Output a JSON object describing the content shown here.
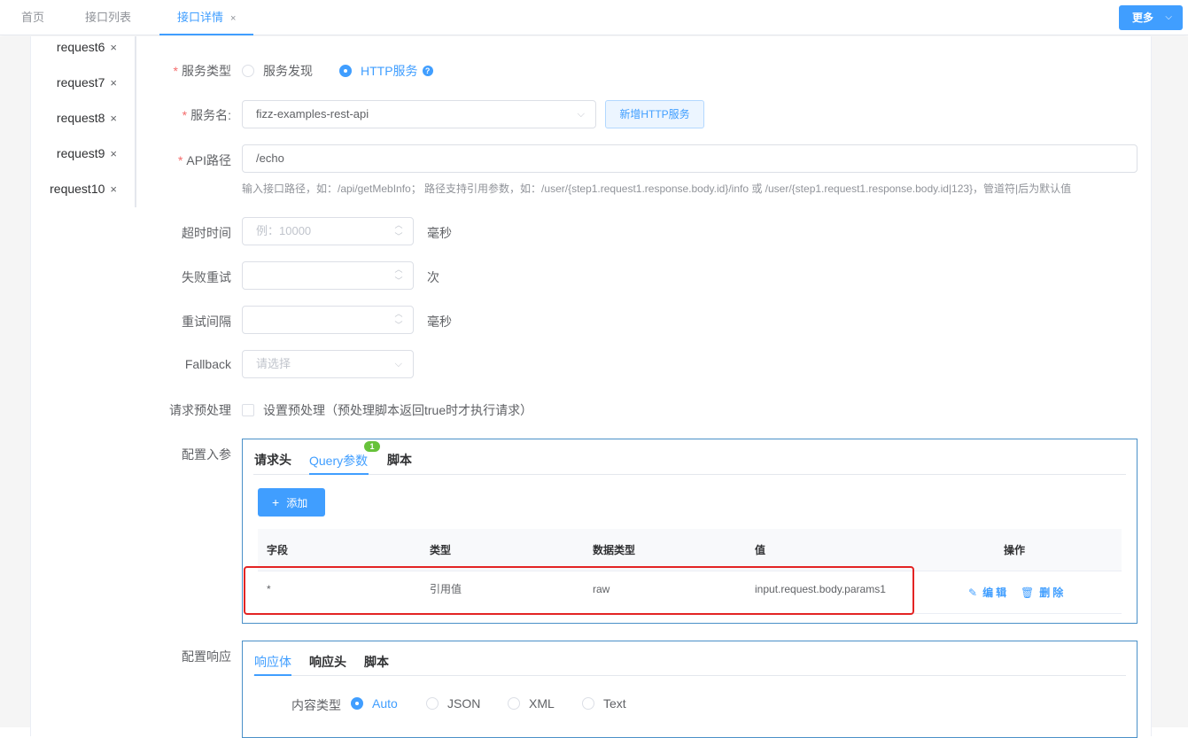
{
  "tabs": [
    {
      "label": "首页"
    },
    {
      "label": "接口列表"
    },
    {
      "label": "接口详情",
      "close": "×"
    }
  ],
  "more_button": {
    "label": "更多",
    "chevron": "⌵"
  },
  "side_requests": [
    {
      "label": "request6",
      "close": "×"
    },
    {
      "label": "request7",
      "close": "×"
    },
    {
      "label": "request8",
      "close": "×"
    },
    {
      "label": "request9",
      "close": "×"
    },
    {
      "label": "request10",
      "close": "×"
    }
  ],
  "form": {
    "service_type": {
      "label": "服务类型",
      "required": "*",
      "options": [
        "服务发现",
        "HTTP服务"
      ],
      "selected": "HTTP服务",
      "help": "?"
    },
    "service_name": {
      "label": "服务名:",
      "required": "*",
      "value": "fizz-examples-rest-api",
      "add_button": "新增HTTP服务"
    },
    "api_path": {
      "label": "API路径",
      "required": "*",
      "value": "/echo",
      "hint": "输入接口路径，如：/api/getMebInfo； 路径支持引用参数，如：/user/{step1.request1.response.body.id}/info 或 /user/{step1.request1.response.body.id|123}，管道符|后为默认值"
    },
    "timeout": {
      "label": "超时时间",
      "placeholder": "例：10000",
      "unit": "毫秒"
    },
    "retry_count": {
      "label": "失败重试",
      "value": "",
      "unit": "次"
    },
    "retry_interval": {
      "label": "重试间隔",
      "value": "",
      "unit": "毫秒"
    },
    "fallback": {
      "label": "Fallback",
      "placeholder": "请选择"
    },
    "preprocess": {
      "label": "请求预处理",
      "checkbox_label": "设置预处理（预处理脚本返回true时才执行请求）",
      "checked": false
    }
  },
  "input_config": {
    "label": "配置入参",
    "tabs": [
      "请求头",
      "Query参数",
      "脚本"
    ],
    "active_tab": "Query参数",
    "badge": "1",
    "add_button": "添加",
    "add_icon": "+",
    "columns": [
      "字段",
      "类型",
      "数据类型",
      "值",
      "操作"
    ],
    "rows": [
      {
        "field": "*",
        "type": "引用值",
        "data_type": "raw",
        "value": "input.request.body.params1"
      }
    ],
    "edit_label": "编辑",
    "delete_label": "删除"
  },
  "response_config": {
    "label": "配置响应",
    "tabs": [
      "响应体",
      "响应头",
      "脚本"
    ],
    "active_tab": "响应体",
    "content_type_label": "内容类型",
    "content_types": [
      "Auto",
      "JSON",
      "XML",
      "Text"
    ],
    "selected_content_type": "Auto"
  },
  "colors": {
    "accent": "#409eff",
    "highlight": "#e32424",
    "badge": "#67c23a",
    "required": "#f56c6c"
  }
}
